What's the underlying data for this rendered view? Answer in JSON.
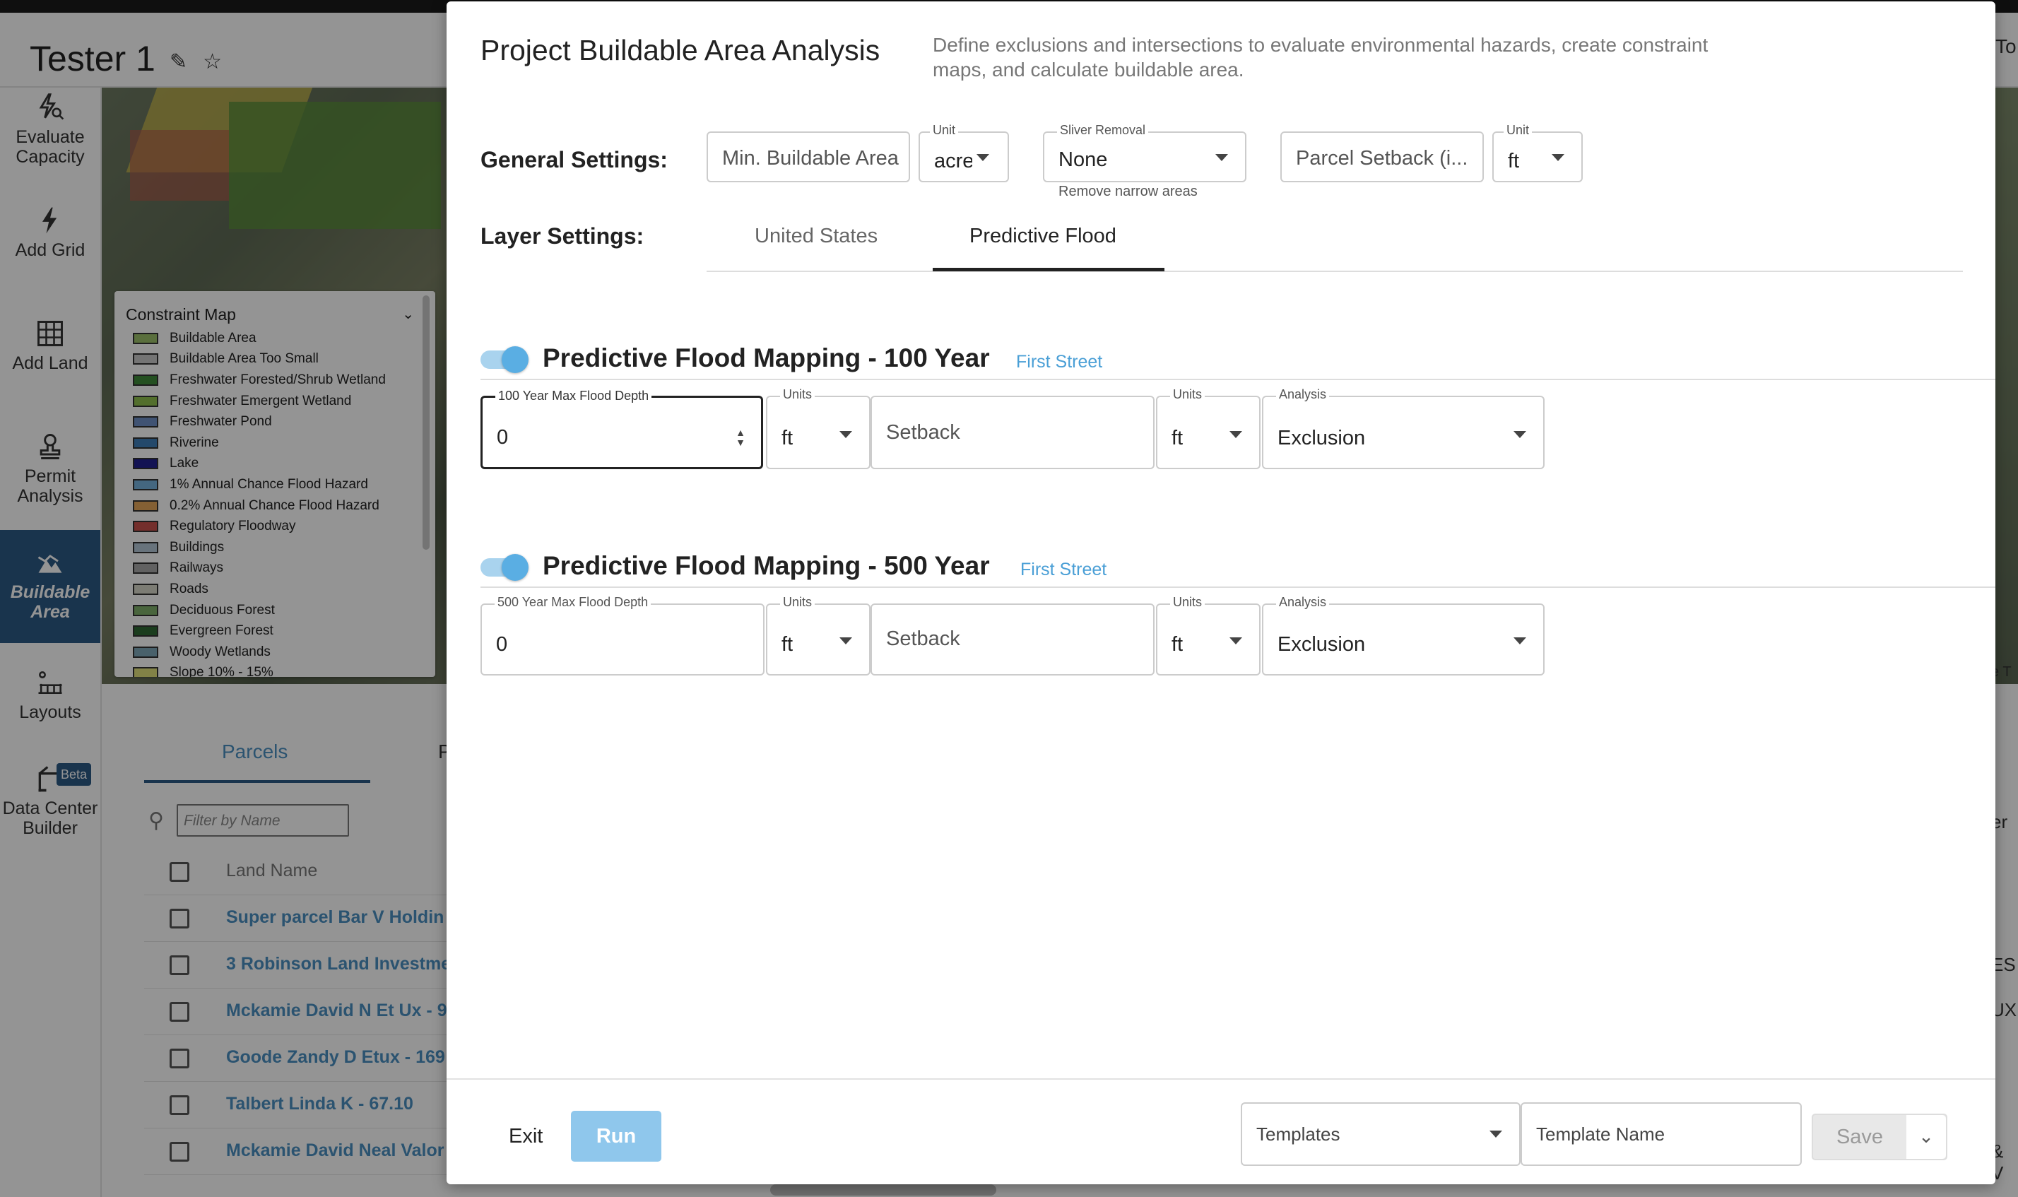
{
  "header": {
    "project_title": "Tester 1",
    "right_text": "To"
  },
  "sidebar": {
    "items": [
      {
        "label": "Evaluate Capacity",
        "icon": "bolt-search-icon"
      },
      {
        "label": "Add Grid",
        "icon": "bolt-icon"
      },
      {
        "label": "Add Land",
        "icon": "grid-icon"
      },
      {
        "label": "Permit Analysis",
        "icon": "stamp-icon"
      },
      {
        "label": "Buildable Area",
        "icon": "terrain-icon",
        "active": true
      },
      {
        "label": "Layouts",
        "icon": "layout-icon"
      },
      {
        "label": "Data Center Builder",
        "icon": "crane-icon",
        "badge": "Beta"
      }
    ]
  },
  "legend": {
    "title": "Constraint Map",
    "items": [
      {
        "label": "Buildable Area",
        "color": "#9bbf6a"
      },
      {
        "label": "Buildable Area Too Small",
        "color": "#c8c8c8"
      },
      {
        "label": "Freshwater Forested/Shrub Wetland",
        "color": "#3f8a3a"
      },
      {
        "label": "Freshwater Emergent Wetland",
        "color": "#8fc04f"
      },
      {
        "label": "Freshwater Pond",
        "color": "#6f8fc7"
      },
      {
        "label": "Riverine",
        "color": "#3f7fb9"
      },
      {
        "label": "Lake",
        "color": "#1f1f8f"
      },
      {
        "label": "1% Annual Chance Flood Hazard",
        "color": "#76b1dd"
      },
      {
        "label": "0.2% Annual Chance Flood Hazard",
        "color": "#e3a55a"
      },
      {
        "label": "Regulatory Floodway",
        "color": "#c8514d"
      },
      {
        "label": "Buildings",
        "color": "#b4c6d6"
      },
      {
        "label": "Railways",
        "color": "#a8a8a8"
      },
      {
        "label": "Roads",
        "color": "#d6d6c8"
      },
      {
        "label": "Deciduous Forest",
        "color": "#7fae6a"
      },
      {
        "label": "Evergreen Forest",
        "color": "#2f6a35"
      },
      {
        "label": "Woody Wetlands",
        "color": "#7fa7b8"
      },
      {
        "label": "Slope 10% - 15%",
        "color": "#e0e07a"
      }
    ]
  },
  "bottom_panel": {
    "tab_parcels": "Parcels",
    "tab_other": "P",
    "filter_placeholder": "Filter by Name",
    "column_header": "Land Name",
    "rows": [
      "Super parcel Bar V Holdin",
      "3 Robinson Land Investme",
      "Mckamie David N Et Ux - 9",
      "Goode Zandy D Etux - 169",
      "Talbert Linda K - 67.10",
      "Mckamie David Neal Valor"
    ],
    "right_fragments": [
      "er",
      "ES",
      "UX",
      "& V",
      "e T"
    ]
  },
  "modal": {
    "title": "Project Buildable Area Analysis",
    "description": "Define exclusions and intersections to evaluate environmental hazards, create constraint maps, and calculate buildable area.",
    "general_settings_label": "General Settings:",
    "min_buildable_area_placeholder": "Min. Buildable Area",
    "unit_label": "Unit",
    "area_unit_value": "acre",
    "sliver_removal_label": "Sliver Removal",
    "sliver_removal_value": "None",
    "sliver_removal_helper": "Remove narrow areas",
    "parcel_setback_placeholder": "Parcel Setback (i...",
    "setback_unit_value": "ft",
    "layer_settings_label": "Layer Settings:",
    "layer_tabs": [
      "United States",
      "Predictive Flood"
    ],
    "active_layer_tab": "Predictive Flood",
    "sections": [
      {
        "title": "Predictive Flood Mapping - 100 Year",
        "source": "First Street",
        "enabled": true,
        "depth_label": "100 Year Max Flood Depth",
        "depth_value": "0",
        "units_label": "Units",
        "depth_unit": "ft",
        "setback_placeholder": "Setback",
        "setback_unit": "ft",
        "analysis_label": "Analysis",
        "analysis_value": "Exclusion"
      },
      {
        "title": "Predictive Flood Mapping - 500 Year",
        "source": "First Street",
        "enabled": true,
        "depth_label": "500 Year Max Flood Depth",
        "depth_value": "0",
        "units_label": "Units",
        "depth_unit": "ft",
        "setback_placeholder": "Setback",
        "setback_unit": "ft",
        "analysis_label": "Analysis",
        "analysis_value": "Exclusion"
      }
    ],
    "footer": {
      "exit_label": "Exit",
      "run_label": "Run",
      "templates_placeholder": "Templates",
      "template_name_placeholder": "Template Name",
      "save_label": "Save"
    }
  }
}
